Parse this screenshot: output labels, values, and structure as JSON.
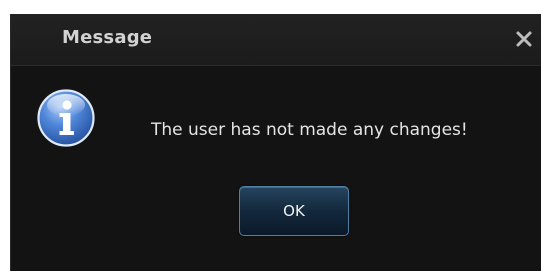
{
  "dialog": {
    "title": "Message",
    "message": "The user has not made any changes!",
    "icon": "info-icon",
    "close_icon": "close-icon",
    "ok_label": "OK"
  },
  "colors": {
    "dialog_background": "#131313",
    "title_text": "#d2d2d2",
    "message_text": "#e4e4e4",
    "button_border": "#4f7fa3",
    "button_fill": "#13283c",
    "info_icon_blue": "#3b6fc6"
  }
}
